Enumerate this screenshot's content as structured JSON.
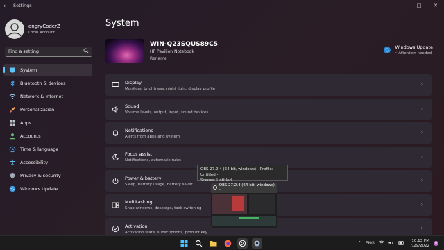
{
  "window": {
    "title": "Settings",
    "controls": [
      "–",
      "□",
      "✕"
    ]
  },
  "user": {
    "name": "angryCoderZ",
    "account_type": "Local Account"
  },
  "search": {
    "placeholder": "Find a setting"
  },
  "sidebar": {
    "items": [
      {
        "label": "System",
        "icon": "monitor-icon",
        "color": "#5ec3f5",
        "active": true
      },
      {
        "label": "Bluetooth & devices",
        "icon": "bluetooth-icon",
        "color": "#4aa7ee"
      },
      {
        "label": "Network & internet",
        "icon": "wifi-icon",
        "color": "#9fd3f7"
      },
      {
        "label": "Personalization",
        "icon": "brush-icon",
        "color": "#f2a35e"
      },
      {
        "label": "Apps",
        "icon": "apps-icon",
        "color": "#bfc6d0"
      },
      {
        "label": "Accounts",
        "icon": "person-icon",
        "color": "#6cc17b"
      },
      {
        "label": "Time & language",
        "icon": "globe-clock-icon",
        "color": "#5aa9e6"
      },
      {
        "label": "Accessibility",
        "icon": "accessibility-icon",
        "color": "#5ec3f5"
      },
      {
        "label": "Privacy & security",
        "icon": "shield-icon",
        "color": "#a0a8b8"
      },
      {
        "label": "Windows Update",
        "icon": "update-icon",
        "color": "#3a96dd"
      }
    ]
  },
  "main": {
    "title": "System",
    "device": {
      "name": "WIN-Q23SQUS89C5",
      "model": "HP Pavilion Notebook",
      "rename": "Rename"
    },
    "windows_update": {
      "title": "Windows Update",
      "status": "Attention needed"
    },
    "cards": [
      {
        "title": "Display",
        "desc": "Monitors, brightness, night light, display profile",
        "icon": "display-icon"
      },
      {
        "title": "Sound",
        "desc": "Volume levels, output, input, sound devices",
        "icon": "speaker-icon"
      },
      {
        "title": "Notifications",
        "desc": "Alerts from apps and system",
        "icon": "bell-icon"
      },
      {
        "title": "Focus assist",
        "desc": "Notifications, automatic rules",
        "icon": "moon-icon"
      },
      {
        "title": "Power & battery",
        "desc": "Sleep, battery usage, battery saver",
        "icon": "power-icon"
      },
      {
        "title": "Multitasking",
        "desc": "Snap windows, desktops, task switching",
        "icon": "multitask-icon"
      },
      {
        "title": "Activation",
        "desc": "Activation state, subscriptions, product key",
        "icon": "check-circle-icon"
      }
    ]
  },
  "tooltip": {
    "line1": "OBS 27.2.4 (64-bit, windows) - Profile: Untitled -",
    "line2": "Scenes: Untitled"
  },
  "preview": {
    "title": "OBS 27.2.4 (64-bit, windows) -..."
  },
  "taskbar": {
    "apps": [
      {
        "icon": "start-icon",
        "color": "#4cc2ff"
      },
      {
        "icon": "search-icon",
        "color": "#ffffff"
      },
      {
        "icon": "file-explorer-icon",
        "color": "#f2c94c"
      },
      {
        "icon": "firefox-icon",
        "color": "#ff7139"
      },
      {
        "icon": "obs-icon",
        "color": "#e8e8e8"
      },
      {
        "icon": "settings-gear-icon",
        "color": "#9fb6d6"
      }
    ],
    "tray": {
      "chevron": "^",
      "language": "ENG",
      "time": "10:13 PM",
      "date": "7/29/2022",
      "notification_count": "6"
    }
  }
}
